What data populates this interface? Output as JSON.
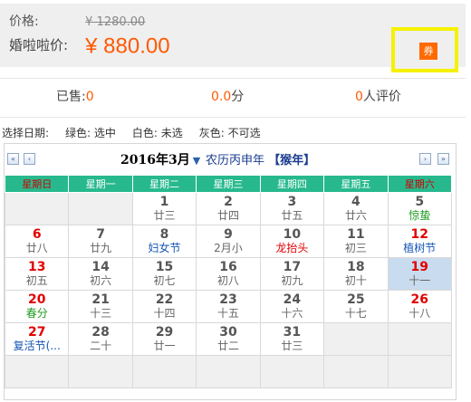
{
  "price": {
    "original_label": "价格:",
    "original_value": "¥ 1280.00",
    "sale_label": "婚啦啦价:",
    "sale_value": "¥ 880.00",
    "coupon_label": "券"
  },
  "stats": {
    "sold_label": "已售:",
    "sold_value": "0",
    "score_value": "0.0",
    "score_unit": "分",
    "review_value": "0",
    "review_unit": "人评价"
  },
  "legend": {
    "title": "选择日期:",
    "green": "绿色: 选中",
    "white": "白色: 未选",
    "gray": "灰色: 不可选"
  },
  "calendar": {
    "month_title": "2016年3月",
    "caret": "▼",
    "lunar_year": "农历丙申年",
    "zodiac": "【猴年】",
    "nav": {
      "prev_year": "«",
      "prev_month": "‹",
      "next_month": "›",
      "next_year": "»"
    },
    "weekdays": [
      "星期日",
      "星期一",
      "星期二",
      "星期三",
      "星期四",
      "星期五",
      "星期六"
    ],
    "weeks": [
      [
        null,
        null,
        {
          "day": "1",
          "lunar": "廿三"
        },
        {
          "day": "2",
          "lunar": "廿四"
        },
        {
          "day": "3",
          "lunar": "廿五"
        },
        {
          "day": "4",
          "lunar": "廿六"
        },
        {
          "day": "5",
          "lunar": "惊蛰",
          "lunar_style": "green"
        }
      ],
      [
        {
          "day": "6",
          "lunar": "廿八",
          "day_style": "red"
        },
        {
          "day": "7",
          "lunar": "廿九"
        },
        {
          "day": "8",
          "lunar": "妇女节",
          "lunar_style": "blue"
        },
        {
          "day": "9",
          "lunar": "2月小"
        },
        {
          "day": "10",
          "lunar": "龙抬头",
          "lunar_style": "red"
        },
        {
          "day": "11",
          "lunar": "初三"
        },
        {
          "day": "12",
          "lunar": "植树节",
          "day_style": "red",
          "lunar_style": "blue"
        }
      ],
      [
        {
          "day": "13",
          "lunar": "初五",
          "day_style": "red"
        },
        {
          "day": "14",
          "lunar": "初六"
        },
        {
          "day": "15",
          "lunar": "初七"
        },
        {
          "day": "16",
          "lunar": "初八"
        },
        {
          "day": "17",
          "lunar": "初九"
        },
        {
          "day": "18",
          "lunar": "初十"
        },
        {
          "day": "19",
          "lunar": "十一",
          "day_style": "red",
          "selected": true
        }
      ],
      [
        {
          "day": "20",
          "lunar": "春分",
          "day_style": "red",
          "lunar_style": "green"
        },
        {
          "day": "21",
          "lunar": "十三"
        },
        {
          "day": "22",
          "lunar": "十四"
        },
        {
          "day": "23",
          "lunar": "十五"
        },
        {
          "day": "24",
          "lunar": "十六"
        },
        {
          "day": "25",
          "lunar": "十七"
        },
        {
          "day": "26",
          "lunar": "十八",
          "day_style": "red"
        }
      ],
      [
        {
          "day": "27",
          "lunar": "复活节(...",
          "day_style": "red",
          "lunar_style": "blue"
        },
        {
          "day": "28",
          "lunar": "二十"
        },
        {
          "day": "29",
          "lunar": "廿一"
        },
        {
          "day": "30",
          "lunar": "廿二"
        },
        {
          "day": "31",
          "lunar": "廿三"
        },
        null,
        null
      ],
      [
        null,
        null,
        null,
        null,
        null,
        null,
        null
      ]
    ]
  }
}
